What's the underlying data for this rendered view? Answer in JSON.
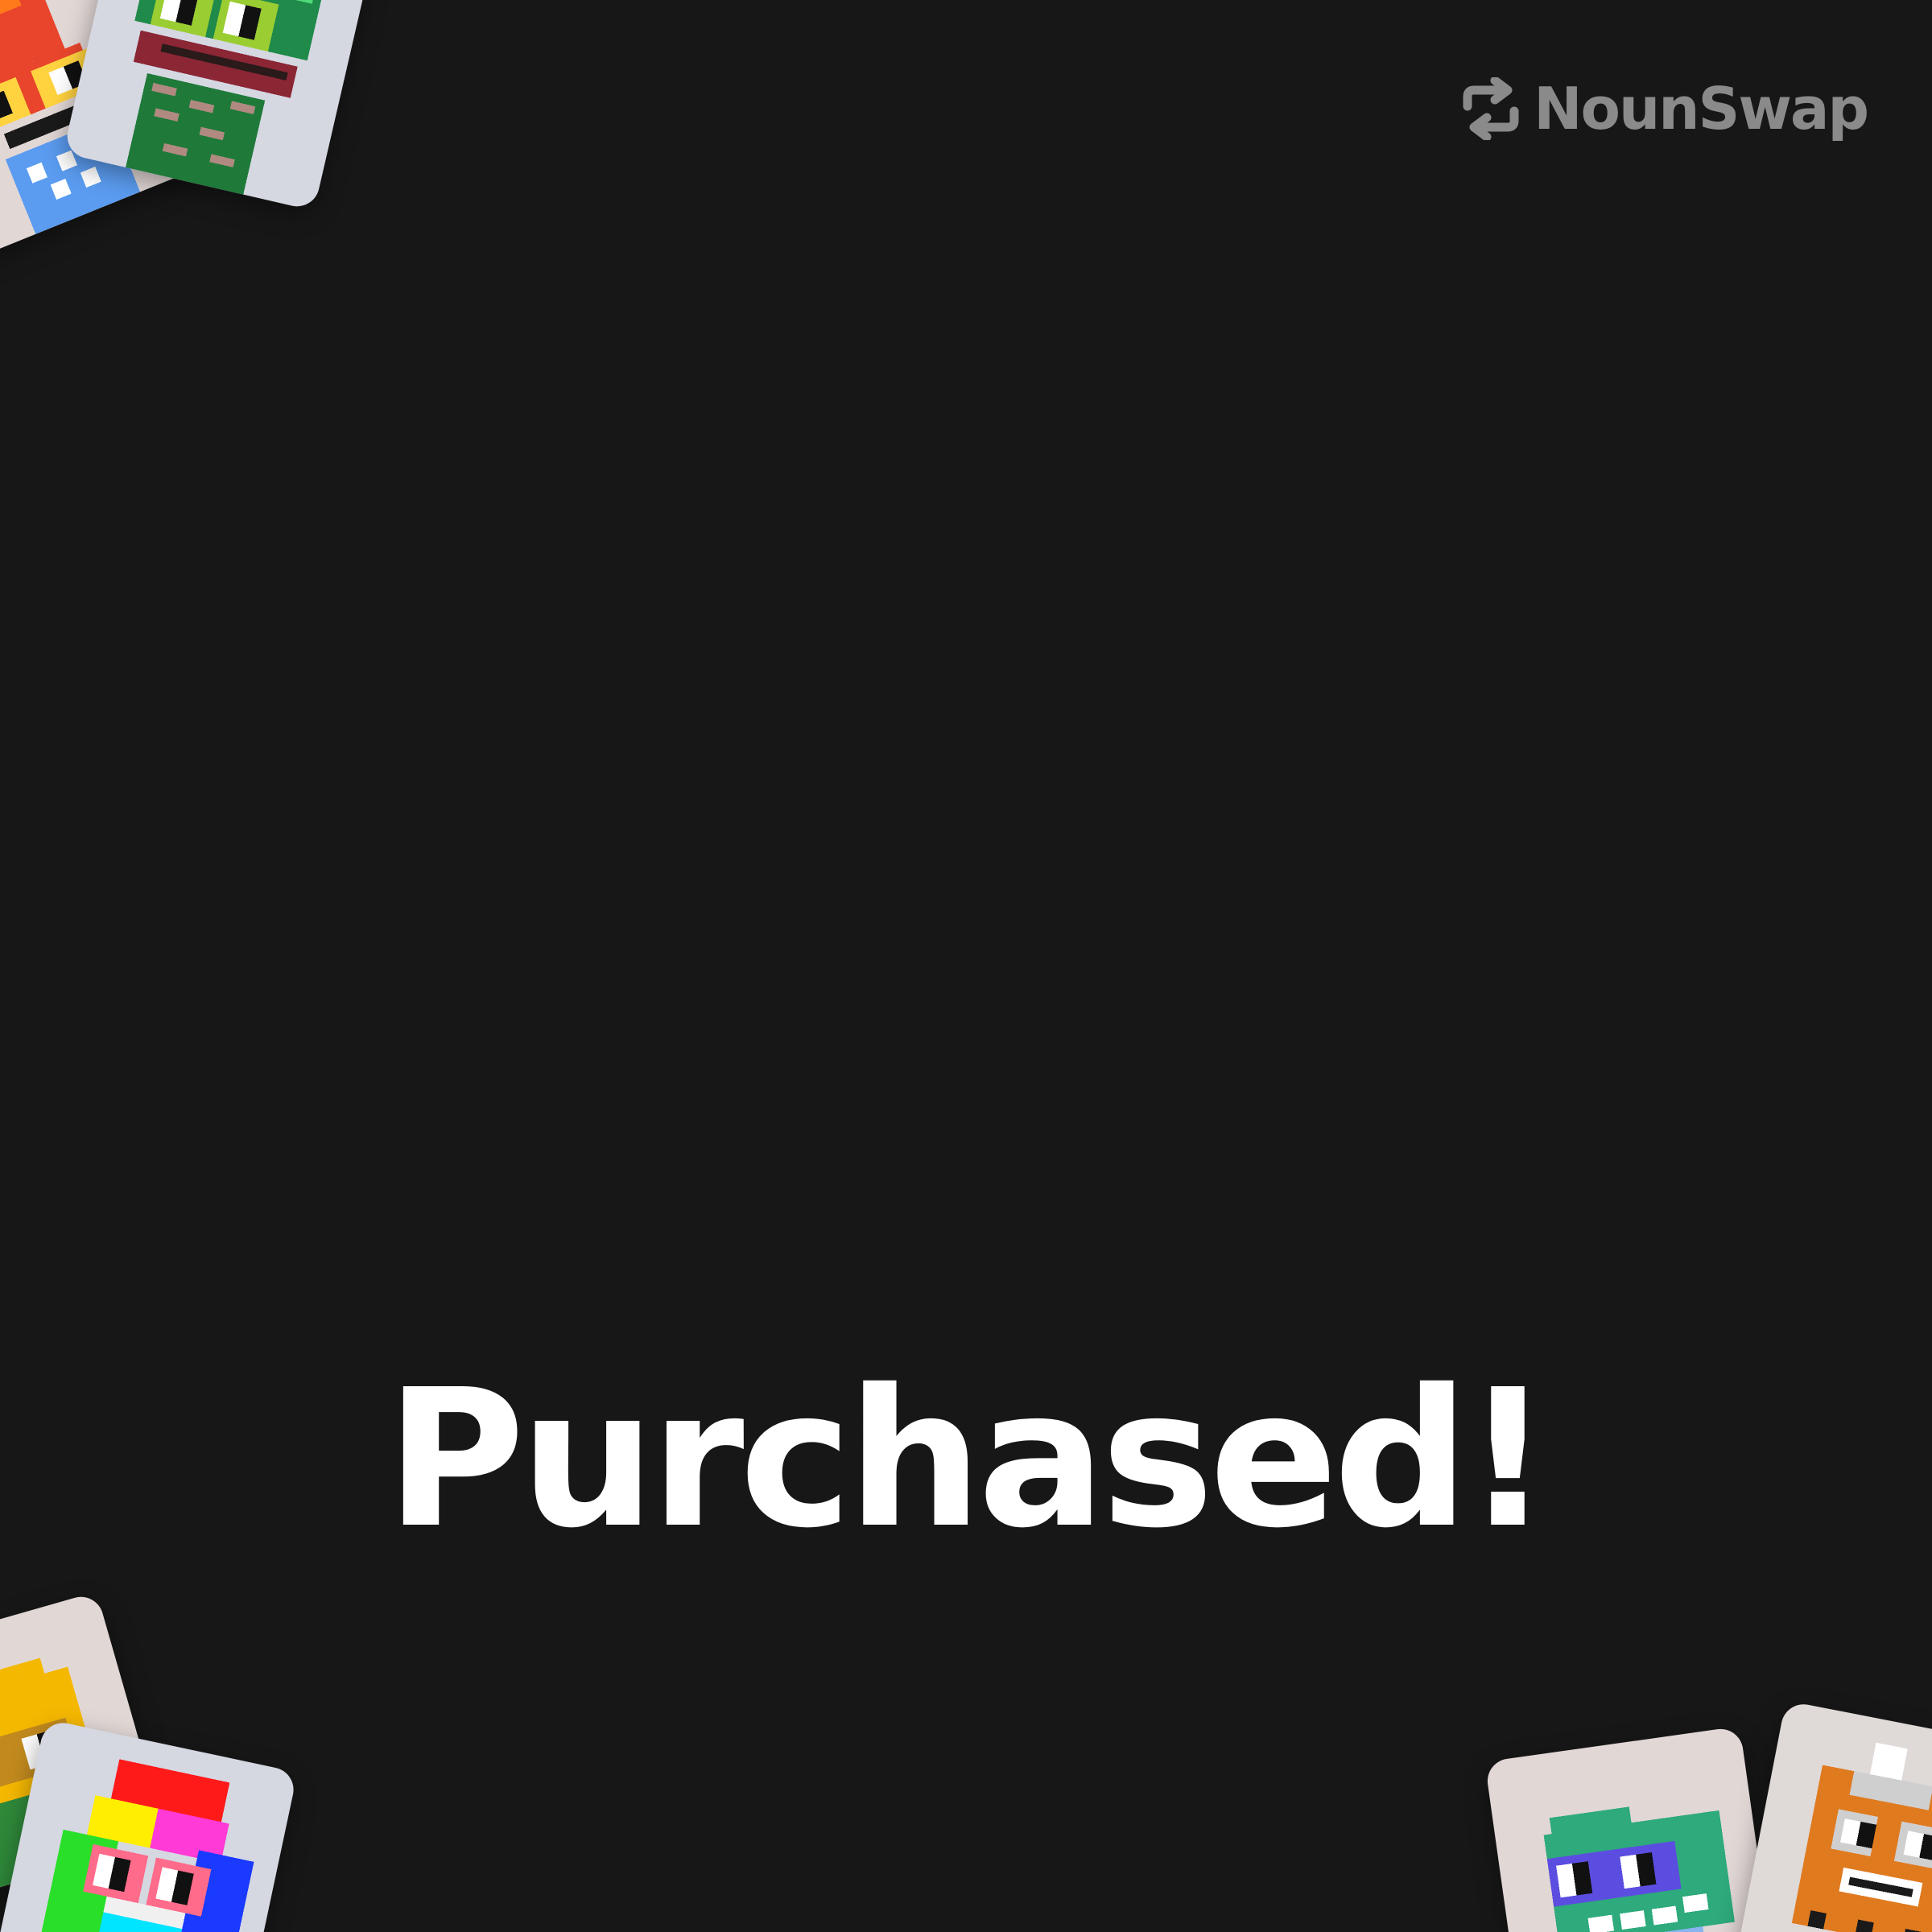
{
  "brand": {
    "name": "NounSwap",
    "icon": "swap-arrows-icon",
    "color": "#8a8a8a"
  },
  "headline": "Purchased!",
  "colors": {
    "background": "#171717",
    "headline": "#ffffff",
    "card_warm": "#e1d7d5",
    "card_cool": "#d5d7e1"
  },
  "nouns": [
    {
      "name": "fire-noun",
      "palette": [
        "#e8452c",
        "#ffd23f",
        "#5b9cf0"
      ]
    },
    {
      "name": "frog-noun",
      "palette": [
        "#1f8a4a",
        "#9acd32",
        "#8b2635"
      ]
    },
    {
      "name": "sun-noun",
      "palette": [
        "#f5b800",
        "#c28a1e",
        "#2f8a3a"
      ]
    },
    {
      "name": "rainbow-noun",
      "palette": [
        "#ff1a1a",
        "#ffee00",
        "#2adf2a",
        "#1a3aff",
        "#00e5ff",
        "#ff3ad6"
      ]
    },
    {
      "name": "green-noun",
      "palette": [
        "#2eaa7c",
        "#5b4de0",
        "#ffffff"
      ]
    },
    {
      "name": "orange-noun",
      "palette": [
        "#e07a1f",
        "#ffffff",
        "#1a1a1a"
      ]
    }
  ]
}
